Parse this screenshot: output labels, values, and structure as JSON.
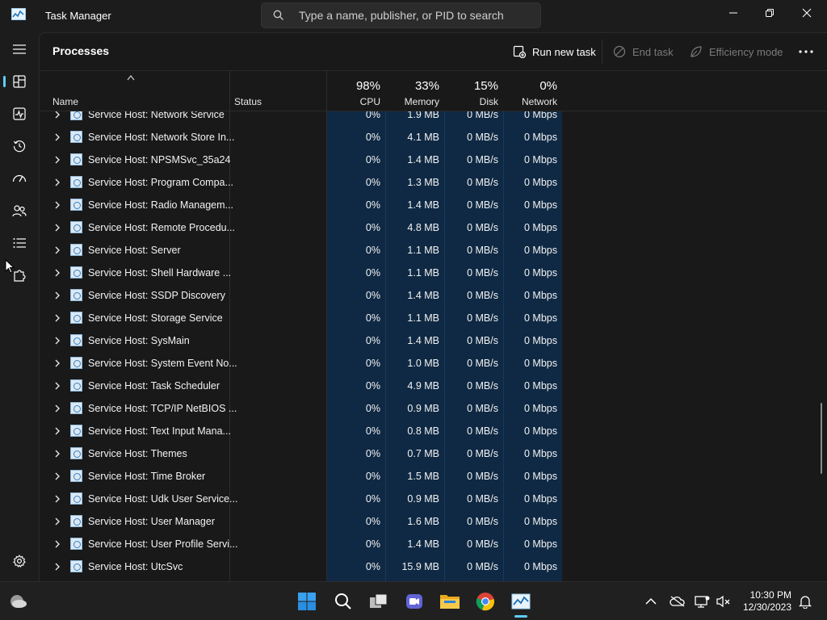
{
  "window": {
    "title": "Task Manager",
    "search_placeholder": "Type a name, publisher, or PID to search"
  },
  "toolbar": {
    "page_title": "Processes",
    "run_new_task": "Run new task",
    "end_task": "End task",
    "efficiency_mode": "Efficiency mode"
  },
  "columns": {
    "name": "Name",
    "status": "Status",
    "cpu": {
      "label": "CPU",
      "pct": "98%"
    },
    "memory": {
      "label": "Memory",
      "pct": "33%"
    },
    "disk": {
      "label": "Disk",
      "pct": "15%"
    },
    "network": {
      "label": "Network",
      "pct": "0%"
    }
  },
  "processes": [
    {
      "name": "Service Host: Network Service",
      "cpu": "0%",
      "memory": "1.9 MB",
      "disk": "0 MB/s",
      "network": "0 Mbps"
    },
    {
      "name": "Service Host: Network Store In...",
      "cpu": "0%",
      "memory": "4.1 MB",
      "disk": "0 MB/s",
      "network": "0 Mbps"
    },
    {
      "name": "Service Host: NPSMSvc_35a24",
      "cpu": "0%",
      "memory": "1.4 MB",
      "disk": "0 MB/s",
      "network": "0 Mbps"
    },
    {
      "name": "Service Host: Program Compa...",
      "cpu": "0%",
      "memory": "1.3 MB",
      "disk": "0 MB/s",
      "network": "0 Mbps"
    },
    {
      "name": "Service Host: Radio Managem...",
      "cpu": "0%",
      "memory": "1.4 MB",
      "disk": "0 MB/s",
      "network": "0 Mbps"
    },
    {
      "name": "Service Host: Remote Procedu...",
      "cpu": "0%",
      "memory": "4.8 MB",
      "disk": "0 MB/s",
      "network": "0 Mbps"
    },
    {
      "name": "Service Host: Server",
      "cpu": "0%",
      "memory": "1.1 MB",
      "disk": "0 MB/s",
      "network": "0 Mbps"
    },
    {
      "name": "Service Host: Shell Hardware ...",
      "cpu": "0%",
      "memory": "1.1 MB",
      "disk": "0 MB/s",
      "network": "0 Mbps"
    },
    {
      "name": "Service Host: SSDP Discovery",
      "cpu": "0%",
      "memory": "1.4 MB",
      "disk": "0 MB/s",
      "network": "0 Mbps"
    },
    {
      "name": "Service Host: Storage Service",
      "cpu": "0%",
      "memory": "1.1 MB",
      "disk": "0 MB/s",
      "network": "0 Mbps"
    },
    {
      "name": "Service Host: SysMain",
      "cpu": "0%",
      "memory": "1.4 MB",
      "disk": "0 MB/s",
      "network": "0 Mbps"
    },
    {
      "name": "Service Host: System Event No...",
      "cpu": "0%",
      "memory": "1.0 MB",
      "disk": "0 MB/s",
      "network": "0 Mbps"
    },
    {
      "name": "Service Host: Task Scheduler",
      "cpu": "0%",
      "memory": "4.9 MB",
      "disk": "0 MB/s",
      "network": "0 Mbps"
    },
    {
      "name": "Service Host: TCP/IP NetBIOS ...",
      "cpu": "0%",
      "memory": "0.9 MB",
      "disk": "0 MB/s",
      "network": "0 Mbps"
    },
    {
      "name": "Service Host: Text Input Mana...",
      "cpu": "0%",
      "memory": "0.8 MB",
      "disk": "0 MB/s",
      "network": "0 Mbps"
    },
    {
      "name": "Service Host: Themes",
      "cpu": "0%",
      "memory": "0.7 MB",
      "disk": "0 MB/s",
      "network": "0 Mbps"
    },
    {
      "name": "Service Host: Time Broker",
      "cpu": "0%",
      "memory": "1.5 MB",
      "disk": "0 MB/s",
      "network": "0 Mbps"
    },
    {
      "name": "Service Host: Udk User Service...",
      "cpu": "0%",
      "memory": "0.9 MB",
      "disk": "0 MB/s",
      "network": "0 Mbps"
    },
    {
      "name": "Service Host: User Manager",
      "cpu": "0%",
      "memory": "1.6 MB",
      "disk": "0 MB/s",
      "network": "0 Mbps"
    },
    {
      "name": "Service Host: User Profile Servi...",
      "cpu": "0%",
      "memory": "1.4 MB",
      "disk": "0 MB/s",
      "network": "0 Mbps"
    },
    {
      "name": "Service Host: UtcSvc",
      "cpu": "0%",
      "memory": "15.9 MB",
      "disk": "0 MB/s",
      "network": "0 Mbps"
    }
  ],
  "taskbar": {
    "time": "10:30 PM",
    "date": "12/30/2023"
  },
  "colors": {
    "accent": "#60cdff",
    "heat_column": "#0f2944",
    "background": "#1c1c1c"
  }
}
